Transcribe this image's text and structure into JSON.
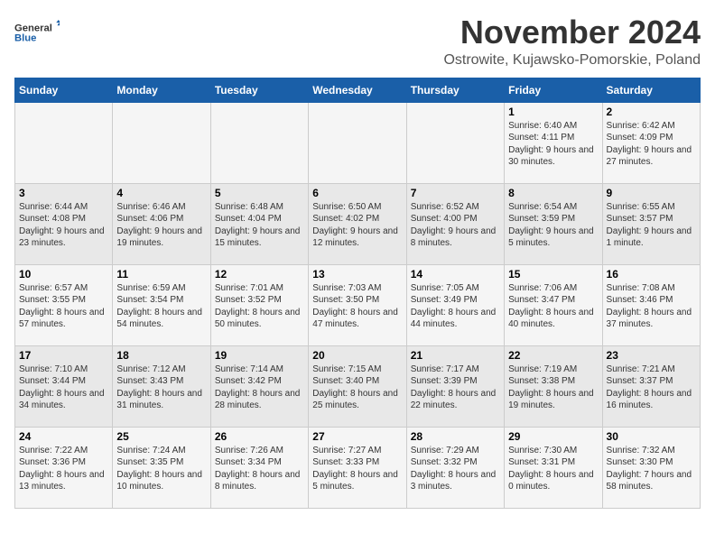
{
  "logo": {
    "general": "General",
    "blue": "Blue"
  },
  "title": "November 2024",
  "location": "Ostrowite, Kujawsko-Pomorskie, Poland",
  "weekdays": [
    "Sunday",
    "Monday",
    "Tuesday",
    "Wednesday",
    "Thursday",
    "Friday",
    "Saturday"
  ],
  "weeks": [
    [
      {
        "day": "",
        "info": ""
      },
      {
        "day": "",
        "info": ""
      },
      {
        "day": "",
        "info": ""
      },
      {
        "day": "",
        "info": ""
      },
      {
        "day": "",
        "info": ""
      },
      {
        "day": "1",
        "info": "Sunrise: 6:40 AM\nSunset: 4:11 PM\nDaylight: 9 hours and 30 minutes."
      },
      {
        "day": "2",
        "info": "Sunrise: 6:42 AM\nSunset: 4:09 PM\nDaylight: 9 hours and 27 minutes."
      }
    ],
    [
      {
        "day": "3",
        "info": "Sunrise: 6:44 AM\nSunset: 4:08 PM\nDaylight: 9 hours and 23 minutes."
      },
      {
        "day": "4",
        "info": "Sunrise: 6:46 AM\nSunset: 4:06 PM\nDaylight: 9 hours and 19 minutes."
      },
      {
        "day": "5",
        "info": "Sunrise: 6:48 AM\nSunset: 4:04 PM\nDaylight: 9 hours and 15 minutes."
      },
      {
        "day": "6",
        "info": "Sunrise: 6:50 AM\nSunset: 4:02 PM\nDaylight: 9 hours and 12 minutes."
      },
      {
        "day": "7",
        "info": "Sunrise: 6:52 AM\nSunset: 4:00 PM\nDaylight: 9 hours and 8 minutes."
      },
      {
        "day": "8",
        "info": "Sunrise: 6:54 AM\nSunset: 3:59 PM\nDaylight: 9 hours and 5 minutes."
      },
      {
        "day": "9",
        "info": "Sunrise: 6:55 AM\nSunset: 3:57 PM\nDaylight: 9 hours and 1 minute."
      }
    ],
    [
      {
        "day": "10",
        "info": "Sunrise: 6:57 AM\nSunset: 3:55 PM\nDaylight: 8 hours and 57 minutes."
      },
      {
        "day": "11",
        "info": "Sunrise: 6:59 AM\nSunset: 3:54 PM\nDaylight: 8 hours and 54 minutes."
      },
      {
        "day": "12",
        "info": "Sunrise: 7:01 AM\nSunset: 3:52 PM\nDaylight: 8 hours and 50 minutes."
      },
      {
        "day": "13",
        "info": "Sunrise: 7:03 AM\nSunset: 3:50 PM\nDaylight: 8 hours and 47 minutes."
      },
      {
        "day": "14",
        "info": "Sunrise: 7:05 AM\nSunset: 3:49 PM\nDaylight: 8 hours and 44 minutes."
      },
      {
        "day": "15",
        "info": "Sunrise: 7:06 AM\nSunset: 3:47 PM\nDaylight: 8 hours and 40 minutes."
      },
      {
        "day": "16",
        "info": "Sunrise: 7:08 AM\nSunset: 3:46 PM\nDaylight: 8 hours and 37 minutes."
      }
    ],
    [
      {
        "day": "17",
        "info": "Sunrise: 7:10 AM\nSunset: 3:44 PM\nDaylight: 8 hours and 34 minutes."
      },
      {
        "day": "18",
        "info": "Sunrise: 7:12 AM\nSunset: 3:43 PM\nDaylight: 8 hours and 31 minutes."
      },
      {
        "day": "19",
        "info": "Sunrise: 7:14 AM\nSunset: 3:42 PM\nDaylight: 8 hours and 28 minutes."
      },
      {
        "day": "20",
        "info": "Sunrise: 7:15 AM\nSunset: 3:40 PM\nDaylight: 8 hours and 25 minutes."
      },
      {
        "day": "21",
        "info": "Sunrise: 7:17 AM\nSunset: 3:39 PM\nDaylight: 8 hours and 22 minutes."
      },
      {
        "day": "22",
        "info": "Sunrise: 7:19 AM\nSunset: 3:38 PM\nDaylight: 8 hours and 19 minutes."
      },
      {
        "day": "23",
        "info": "Sunrise: 7:21 AM\nSunset: 3:37 PM\nDaylight: 8 hours and 16 minutes."
      }
    ],
    [
      {
        "day": "24",
        "info": "Sunrise: 7:22 AM\nSunset: 3:36 PM\nDaylight: 8 hours and 13 minutes."
      },
      {
        "day": "25",
        "info": "Sunrise: 7:24 AM\nSunset: 3:35 PM\nDaylight: 8 hours and 10 minutes."
      },
      {
        "day": "26",
        "info": "Sunrise: 7:26 AM\nSunset: 3:34 PM\nDaylight: 8 hours and 8 minutes."
      },
      {
        "day": "27",
        "info": "Sunrise: 7:27 AM\nSunset: 3:33 PM\nDaylight: 8 hours and 5 minutes."
      },
      {
        "day": "28",
        "info": "Sunrise: 7:29 AM\nSunset: 3:32 PM\nDaylight: 8 hours and 3 minutes."
      },
      {
        "day": "29",
        "info": "Sunrise: 7:30 AM\nSunset: 3:31 PM\nDaylight: 8 hours and 0 minutes."
      },
      {
        "day": "30",
        "info": "Sunrise: 7:32 AM\nSunset: 3:30 PM\nDaylight: 7 hours and 58 minutes."
      }
    ]
  ]
}
